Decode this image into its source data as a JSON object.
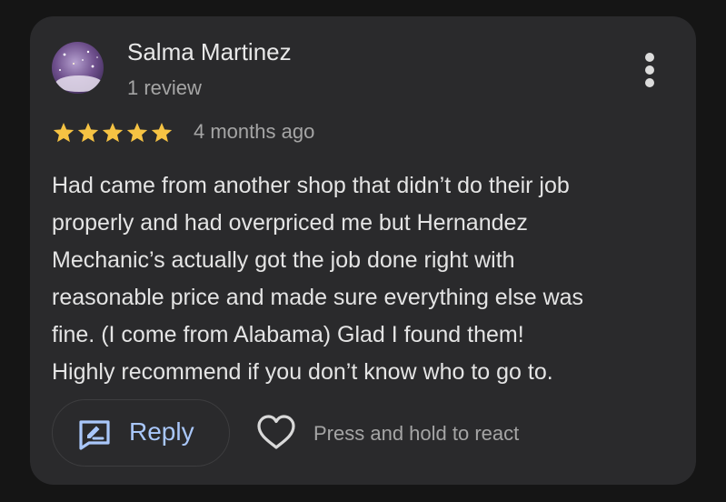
{
  "colors": {
    "page_background": "#151515",
    "card_background": "#2a2a2c",
    "star": "#f6c343",
    "accent": "#a9c7fa"
  },
  "review": {
    "reviewer_name": "Salma Martinez",
    "review_count": "1 review",
    "rating": 5,
    "rating_max": 5,
    "time_ago": "4 months ago",
    "text_lines": [
      "Had came from another shop that didn’t do their job",
      "properly and had overpriced me but Hernandez",
      "Mechanic’s actually got the job done right with",
      "reasonable price and made sure everything else was",
      "fine. (I come from Alabama) Glad I found them!",
      "Highly recommend if you don’t know who to go to."
    ]
  },
  "actions": {
    "reply_label": "Reply",
    "reply_icon": "edit-reply-icon",
    "react_icon": "heart-icon",
    "react_hint": "Press and hold to react",
    "more_icon": "more-vert-icon"
  }
}
